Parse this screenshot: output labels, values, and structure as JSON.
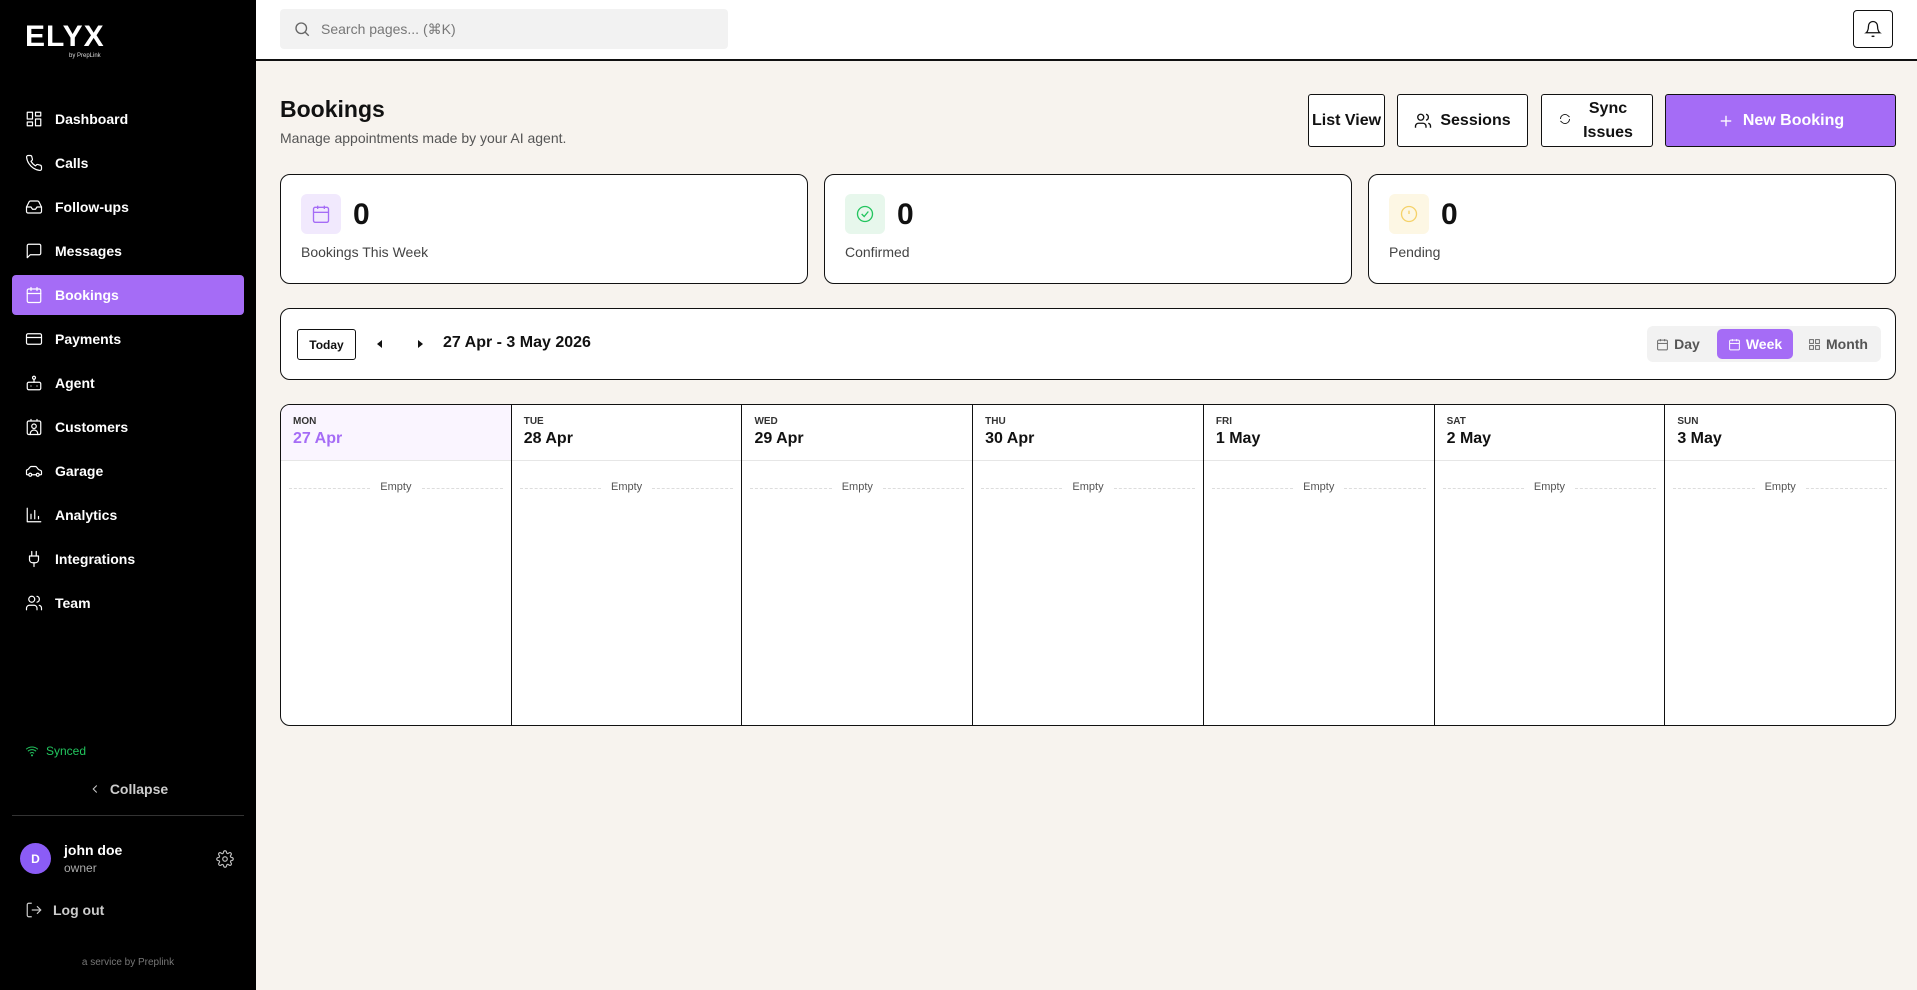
{
  "brand": {
    "name": "ELYX",
    "sub": "by PrepLink",
    "footer": "a service by Preplink"
  },
  "sidebar": {
    "items": [
      {
        "label": "Dashboard",
        "icon": "dashboard-icon"
      },
      {
        "label": "Calls",
        "icon": "phone-icon"
      },
      {
        "label": "Follow-ups",
        "icon": "inbox-icon"
      },
      {
        "label": "Messages",
        "icon": "message-icon"
      },
      {
        "label": "Bookings",
        "icon": "calendar-icon",
        "active": true
      },
      {
        "label": "Payments",
        "icon": "card-icon"
      },
      {
        "label": "Agent",
        "icon": "bot-icon"
      },
      {
        "label": "Customers",
        "icon": "contact-icon"
      },
      {
        "label": "Garage",
        "icon": "car-icon"
      },
      {
        "label": "Analytics",
        "icon": "chart-icon"
      },
      {
        "label": "Integrations",
        "icon": "plug-icon"
      },
      {
        "label": "Team",
        "icon": "users-icon"
      }
    ],
    "status": "Synced",
    "collapse": "Collapse",
    "user": {
      "initial": "D",
      "name": "john doe",
      "role": "owner"
    },
    "logout": "Log out"
  },
  "search": {
    "placeholder": "Search pages... (⌘K)"
  },
  "header": {
    "title": "Bookings",
    "subtitle": "Manage appointments made by your AI agent.",
    "list_view": "List View",
    "sessions": "Sessions",
    "sync_issues": "Sync Issues",
    "new_booking": "New Booking"
  },
  "stats": [
    {
      "value": "0",
      "label": "Bookings This Week"
    },
    {
      "value": "0",
      "label": "Confirmed"
    },
    {
      "value": "0",
      "label": "Pending"
    }
  ],
  "calendar": {
    "today": "Today",
    "range": "27 Apr - 3 May 2026",
    "views": {
      "day": "Day",
      "week": "Week",
      "month": "Month"
    },
    "active_view": "Week",
    "days": [
      {
        "name": "MON",
        "date": "27 Apr",
        "empty": "Empty"
      },
      {
        "name": "TUE",
        "date": "28 Apr",
        "empty": "Empty"
      },
      {
        "name": "WED",
        "date": "29 Apr",
        "empty": "Empty"
      },
      {
        "name": "THU",
        "date": "30 Apr",
        "empty": "Empty"
      },
      {
        "name": "FRI",
        "date": "1 May",
        "empty": "Empty"
      },
      {
        "name": "SAT",
        "date": "2 May",
        "empty": "Empty"
      },
      {
        "name": "SUN",
        "date": "3 May",
        "empty": "Empty"
      }
    ]
  },
  "colors": {
    "accent": "#a56cf6",
    "success": "#22c55e",
    "sidebar_bg": "#000000",
    "page_bg": "#f7f3ee"
  }
}
